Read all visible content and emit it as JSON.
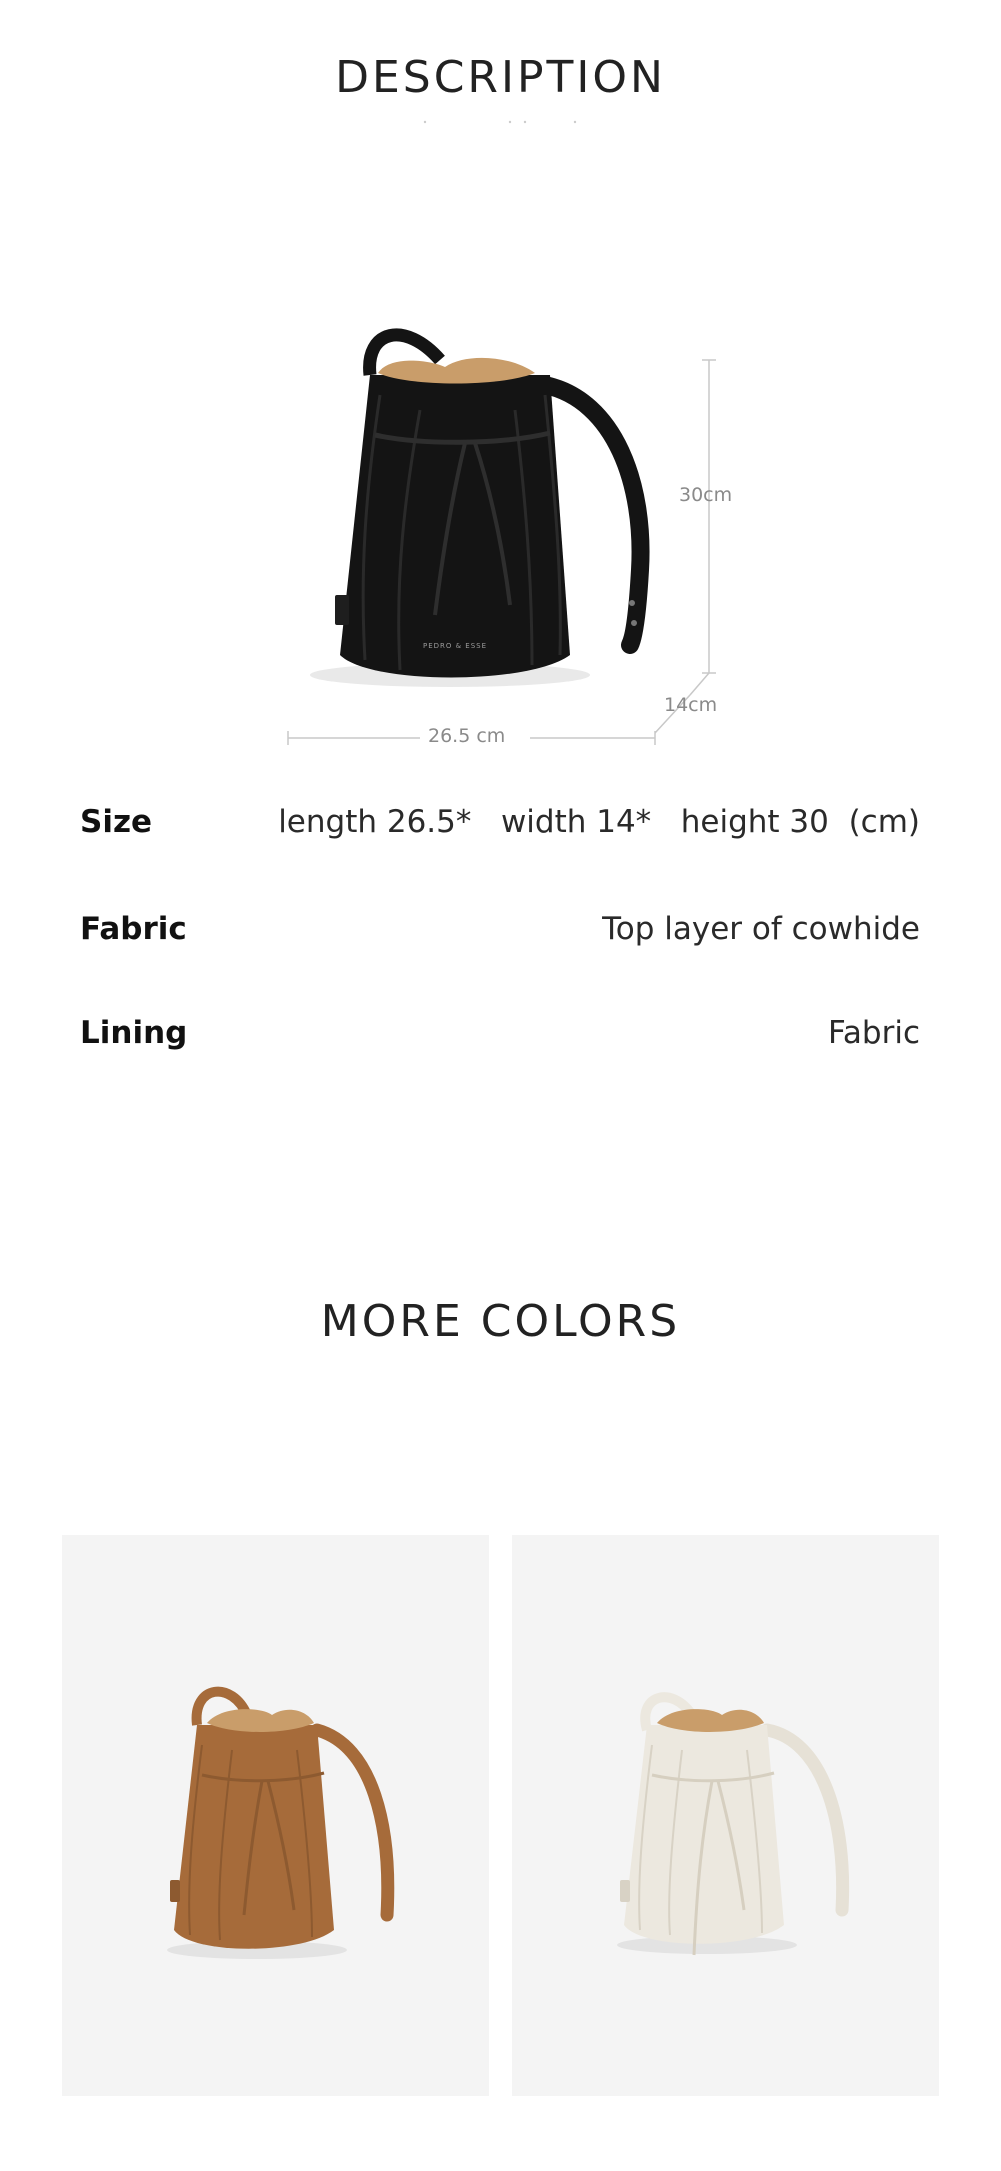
{
  "description": {
    "title": "DESCRIPTION",
    "dimension_labels": {
      "height": "30cm",
      "depth": "14cm",
      "length": "26.5 cm"
    },
    "bag_brand_text": "PEDRO & ESSE"
  },
  "specs": [
    {
      "label": "Size",
      "value": "length 26.5*   width 14*   height 30  (cm)"
    },
    {
      "label": "Fabric",
      "value": "Top layer of cowhide"
    },
    {
      "label": "Lining",
      "value": "Fabric"
    }
  ],
  "more_colors": {
    "title": "MORE COLORS",
    "items": [
      {
        "color_name": "brown",
        "hex": "#a66b3a"
      },
      {
        "color_name": "cream",
        "hex": "#ece8df"
      }
    ]
  },
  "colors": {
    "background": "#ffffff",
    "card_background": "#f4f4f4",
    "bag_black": "#141414",
    "bag_interior": "#c99d6a",
    "dimension_line": "#c8c8c8"
  }
}
